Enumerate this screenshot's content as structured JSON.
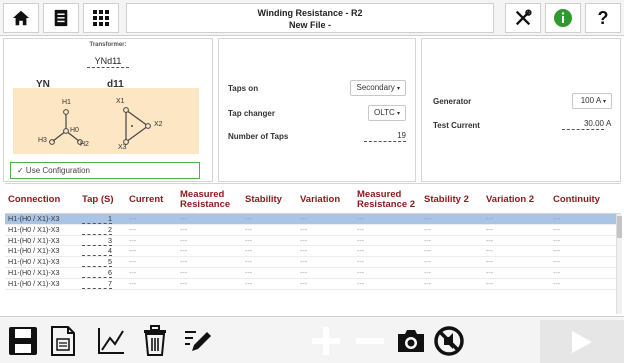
{
  "window": {
    "title_line1": "Winding Resistance - R2",
    "title_line2": "New File -"
  },
  "icons": {
    "home": "home-icon",
    "document": "document-icon",
    "grid": "grid-icon",
    "tools": "tools-icon",
    "info": "info-icon",
    "help": "help-icon"
  },
  "colors": {
    "header_text": "#8b1a1a",
    "selected_row": "#a9c4e4",
    "use_config_border": "#4caf50",
    "info_green": "#2e9b2e",
    "diagram_bg": "#fde6c3"
  },
  "transformer": {
    "label": "Transformer:",
    "value": "YNd11",
    "primary_group": "YN",
    "secondary_group": "d11",
    "nodes": {
      "h1": "H1",
      "h0": "H0",
      "h2": "H2",
      "h3": "H3",
      "x1": "X1",
      "x2": "X2",
      "x3": "X3"
    },
    "use_configuration": "✓ Use Configuration"
  },
  "taps": {
    "taps_on_label": "Taps on",
    "taps_on_value": "Secondary",
    "tap_changer_label": "Tap changer",
    "tap_changer_value": "OLTC",
    "num_taps_label": "Number of Taps",
    "num_taps_value": "19"
  },
  "generator": {
    "generator_label": "Generator",
    "generator_value": "100 A",
    "test_current_label": "Test Current",
    "test_current_value": "30.00",
    "test_current_unit": "A"
  },
  "table": {
    "headers": {
      "connection": "Connection",
      "tap": "Tap (S)",
      "current": "Current",
      "measured_resistance_1": "Measured",
      "measured_resistance_2": "Resistance",
      "stability": "Stability",
      "variation": "Variation",
      "measured_resistance2_1": "Measured",
      "measured_resistance2_2": "Resistance 2",
      "stability2": "Stability 2",
      "variation2": "Variation 2",
      "continuity": "Continuity"
    },
    "rows": [
      {
        "connection": "H1-(H0 / X1)-X3",
        "tap": "1",
        "current": "---",
        "mres": "---",
        "stab": "---",
        "var": "---",
        "mres2": "---",
        "stab2": "---",
        "var2": "---",
        "cont": "---"
      },
      {
        "connection": "H1-(H0 / X1)-X3",
        "tap": "2",
        "current": "---",
        "mres": "---",
        "stab": "---",
        "var": "---",
        "mres2": "---",
        "stab2": "---",
        "var2": "---",
        "cont": "---"
      },
      {
        "connection": "H1-(H0 / X1)-X3",
        "tap": "3",
        "current": "---",
        "mres": "---",
        "stab": "---",
        "var": "---",
        "mres2": "---",
        "stab2": "---",
        "var2": "---",
        "cont": "---"
      },
      {
        "connection": "H1-(H0 / X1)-X3",
        "tap": "4",
        "current": "---",
        "mres": "---",
        "stab": "---",
        "var": "---",
        "mres2": "---",
        "stab2": "---",
        "var2": "---",
        "cont": "---"
      },
      {
        "connection": "H1-(H0 / X1)-X3",
        "tap": "5",
        "current": "---",
        "mres": "---",
        "stab": "---",
        "var": "---",
        "mres2": "---",
        "stab2": "---",
        "var2": "---",
        "cont": "---"
      },
      {
        "connection": "H1-(H0 / X1)-X3",
        "tap": "6",
        "current": "---",
        "mres": "---",
        "stab": "---",
        "var": "---",
        "mres2": "---",
        "stab2": "---",
        "var2": "---",
        "cont": "---"
      },
      {
        "connection": "H1-(H0 / X1)-X3",
        "tap": "7",
        "current": "---",
        "mres": "---",
        "stab": "---",
        "var": "---",
        "mres2": "---",
        "stab2": "---",
        "var2": "---",
        "cont": "---"
      }
    ]
  },
  "bottom_icons": [
    "save-icon",
    "report-icon",
    "graph-icon",
    "delete-icon",
    "edit-icon",
    "add-icon",
    "remove-icon",
    "camera-icon",
    "no-sound-icon",
    "play-icon"
  ]
}
